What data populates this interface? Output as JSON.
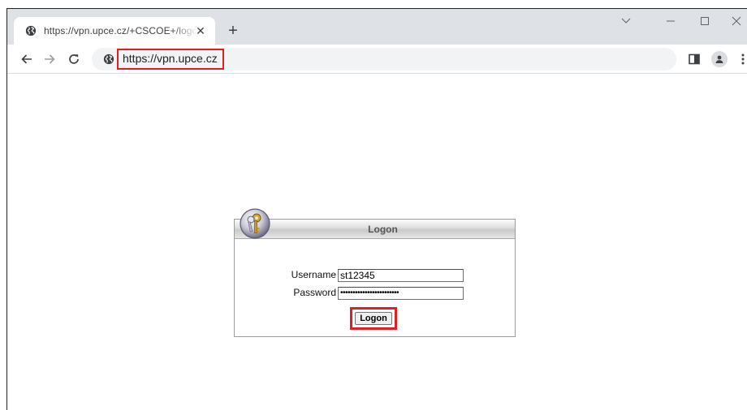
{
  "browser": {
    "tab": {
      "title": "https://vpn.upce.cz/+CSCOE+/logon.html",
      "close_glyph": "✕"
    },
    "new_tab_glyph": "+",
    "address_bar": {
      "url": "https://vpn.upce.cz"
    },
    "icons": {
      "tab_favicon": "globe-icon",
      "back": "arrow-left-icon",
      "forward": "arrow-right-icon",
      "reload": "reload-icon",
      "site_info": "globe-icon",
      "side_panel": "side-panel-icon",
      "profile": "profile-icon",
      "menu": "kebab-menu-icon",
      "tab_search": "chevron-down-icon",
      "minimize": "minimize-icon",
      "maximize": "maximize-icon",
      "close": "close-icon"
    }
  },
  "logon": {
    "header_title": "Logon",
    "username_label": "Username",
    "username_value": "st12345",
    "password_label": "Password",
    "password_value": "••••••••••••••••••••••••",
    "submit_label": "Logon"
  },
  "colors": {
    "highlight": "#e01f25",
    "tabstrip": "#dee1e6",
    "omnibox": "#f1f3f4"
  }
}
